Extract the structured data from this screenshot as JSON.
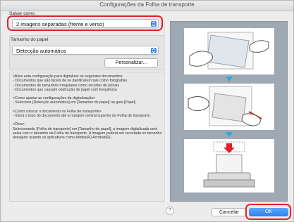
{
  "window": {
    "title": "Configurações da Folha de transporte"
  },
  "save_as": {
    "label": "Salvar como",
    "value": "2 imagens separadas (frente e verso)"
  },
  "paper_size": {
    "label": "Tamanho do papel",
    "value": "Detecção automática",
    "customize_button": "Personalizar..."
  },
  "info": {
    "intro": "Utilize esta configuração para digitalizar os seguintes documentos:",
    "bullets": [
      "- Documentos que são fáceis de se danificarem tais como fotografias",
      "- Documentos de tamanhos irregulares como recortes de jornais",
      "- Documentos que causam obstrução de papel com frequência"
    ],
    "adjust_heading": "<Como ajustar as configurações da digitalização>",
    "adjust_text": "- Selecione [Detecção automática] em [Tamanho do papel] na guia [Papel].",
    "place_heading": "<Como colocar o documento na Folha de transporte>",
    "place_text": "- Insira o topo do documento até a margem central superior da Folha de transporte.",
    "tip_heading": "<Dica>",
    "tip_text": "Selecionando [Folha de transporte] em [Tamanho do papel], a imagem digitalizada será salva com o tamanho da Folha de transporte. A imagem poderá ser recortada no tamanho desejado usando os aplicativos como Adobe(R) Acrobat(R)."
  },
  "buttons": {
    "help": "?",
    "cancel": "Cancelar",
    "ok": "OK"
  },
  "colors": {
    "accent": "#2f7ff0",
    "highlight": "#e3202a",
    "arrow": "#2fa8e0"
  }
}
